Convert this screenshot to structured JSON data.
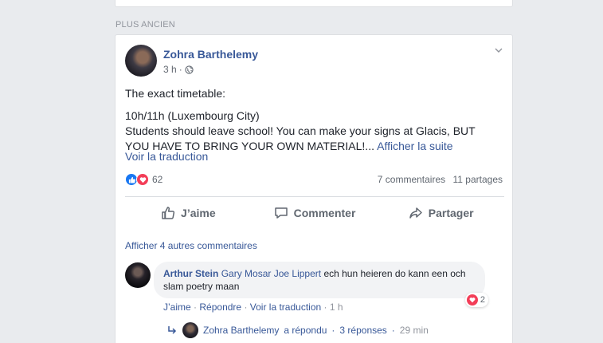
{
  "feed": {
    "section_label": "PLUS ANCIEN"
  },
  "post": {
    "author": "Zohra Barthelemy",
    "time": "3 h",
    "separator": "·",
    "text_line1": "The exact timetable:",
    "text_line2": "10h/11h (Luxembourg City)",
    "text_line3": "Students should leave school! You can make your signs at Glacis, BUT",
    "text_line4": "YOU HAVE TO BRING YOUR OWN MATERIAL!...",
    "see_more": "Afficher la suite",
    "translate": "Voir la traduction",
    "reactions_count": "62",
    "comments_count": "7 commentaires",
    "shares_count": "11 partages",
    "icons": {
      "privacy": "globe-icon",
      "menu": "chevron-down-icon",
      "like": "like-reaction-icon",
      "love": "love-reaction-icon"
    },
    "colors": {
      "link": "#385898",
      "like": "#1877f2",
      "love": "#f33e58"
    }
  },
  "actions": {
    "like": "J’aime",
    "comment": "Commenter",
    "share": "Partager"
  },
  "comments": {
    "more": "Afficher 4 autres commentaires",
    "first": {
      "author": "Arthur Stein",
      "tag1": "Gary Mosar",
      "tag2": "Joe Lippert",
      "text": "ech hun heieren do kann een och slam poetry maan",
      "reaction_count": "2",
      "like": "J’aime",
      "reply": "Répondre",
      "translate": "Voir la traduction",
      "time": "1 h",
      "dot": "·"
    },
    "reply_summary": {
      "author": "Zohra Barthelemy",
      "text": "a répondu",
      "count": "3 réponses",
      "time": "29 min",
      "dot": "·"
    }
  }
}
